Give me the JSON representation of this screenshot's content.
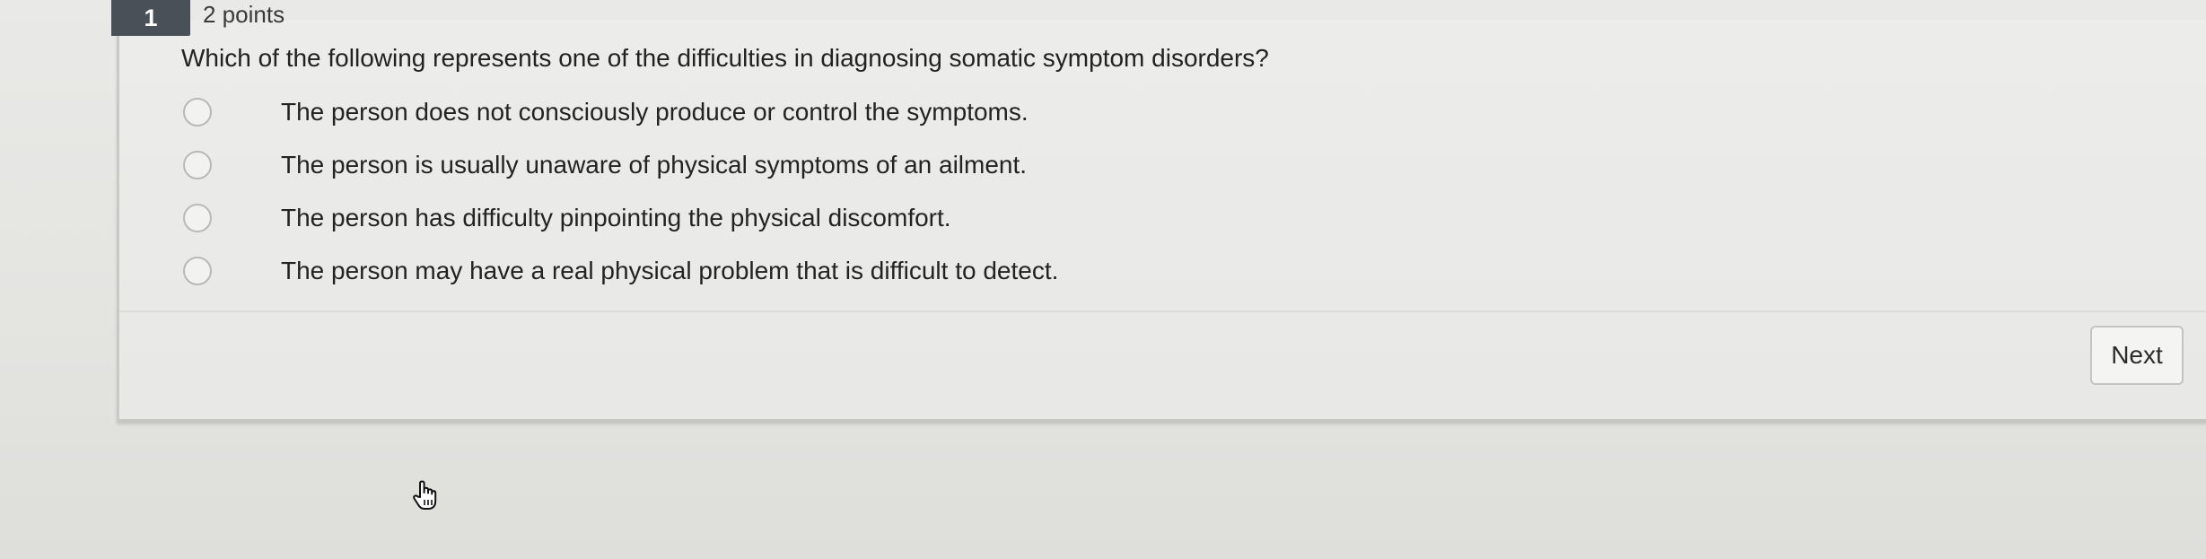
{
  "question": {
    "number": "1",
    "points": "2 points",
    "prompt": "Which of the following represents one of the difficulties in diagnosing somatic symptom disorders?",
    "choices": [
      {
        "label": "The person does not consciously produce or control the symptoms.",
        "selected": false
      },
      {
        "label": "The person is usually unaware of physical symptoms of an ailment.",
        "selected": false
      },
      {
        "label": "The person has difficulty pinpointing the physical discomfort.",
        "selected": false
      },
      {
        "label": "The person may have a real physical problem that is difficult to detect.",
        "selected": false
      }
    ]
  },
  "navigation": {
    "next_label": "Next"
  },
  "cursor": {
    "icon": "hand-pointer-icon"
  },
  "colors": {
    "badge_bg": "#4a5058",
    "page_bg": "#e6e6e4",
    "text": "#262626",
    "radio_border": "#b9b9b6"
  }
}
